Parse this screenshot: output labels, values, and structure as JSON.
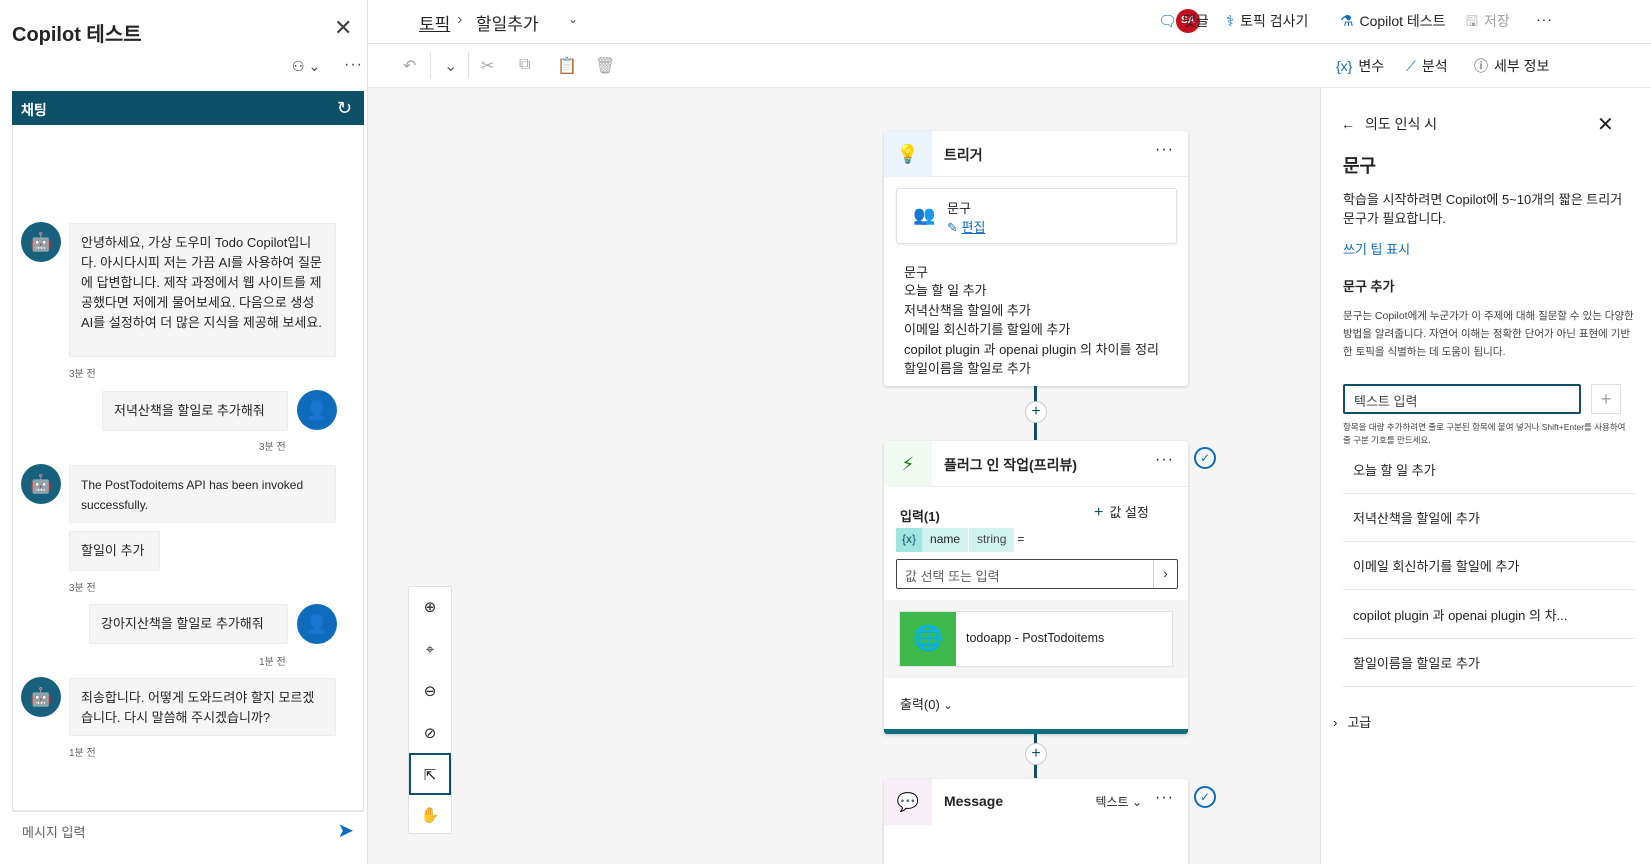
{
  "left_panel": {
    "title": "Copilot 테스트",
    "chat_tab": "채팅",
    "messages": [
      {
        "role": "bot",
        "text": "안녕하세요, 가상 도우미 Todo Copilot입니다. 아시다시피 저는 가끔 AI를 사용하여 질문에 답변합니다. 제작 과정에서 웹 사이트를 제공했다면 저에게 물어보세요. 다음으로 생성 AI를 설정하여 더 많은 지식을 제공해 보세요.",
        "time": "3분 전"
      },
      {
        "role": "user",
        "text": "저녁산책을 할일로 추가해줘",
        "time": "3분 전"
      },
      {
        "role": "bot",
        "text": "The PostTodoitems API has been invoked successfully."
      },
      {
        "role": "bot",
        "text": "할일이 추가",
        "time": "3분 전"
      },
      {
        "role": "user",
        "text": "강아지산책을 할일로 추가해줘",
        "time": "1분 전"
      },
      {
        "role": "bot",
        "text": "죄송합니다. 어떻게 도와드려야 할지 모르겠습니다. 다시 말씀해 주시겠습니까?",
        "time": "1분 전"
      }
    ],
    "input_placeholder": "메시지 입력"
  },
  "topbar": {
    "breadcrumb_root": "토픽",
    "breadcrumb_current": "할일추가",
    "avatar_initials": "SA",
    "comments": "댓글",
    "topic_checker": "토픽 검사기",
    "test_copilot": "Copilot 테스트",
    "save": "저장"
  },
  "toolbar2": {
    "variables": "변수",
    "analytics": "분석",
    "details": "세부 정보"
  },
  "canvas": {
    "trigger_card": {
      "title": "트리거",
      "phrase_label": "문구",
      "edit_link": "편집",
      "phrases_heading": "문구",
      "phrases": [
        "오늘 할 일 추가",
        "저녁산책을 할일에 추가",
        "이메일 회신하기를 할일에 추가",
        "copilot plugin 과 openai plugin 의 차이를 정리",
        "할일이름을 할일로 추가"
      ]
    },
    "plugin_card": {
      "title": "플러그 인 작업(프리뷰)",
      "inputs_label": "입력(1)",
      "set_value": "값 설정",
      "var_token": "{x}",
      "var_name": "name",
      "var_type": "string",
      "equals": "=",
      "value_placeholder": "값 선택 또는 입력",
      "action_name": "todoapp - PostTodoitems",
      "outputs_label": "출력(0)"
    },
    "message_card": {
      "title": "Message",
      "mode": "텍스트"
    }
  },
  "right_panel": {
    "back_label": "의도 인식 시",
    "heading": "문구",
    "description": "학습을 시작하려면 Copilot에 5~10개의 짧은 트리거 문구가 필요합니다.",
    "tips_link": "쓰기 팁 표시",
    "add_heading": "문구 추가",
    "add_description": "문구는 Copilot에게 누군가가 이 주제에 대해 질문할 수 있는 다양한 방법을 알려줍니다. 자연어 이해는 정확한 단어가 아닌 표현에 기반한 토픽을 식별하는 데 도움이 됩니다.",
    "input_placeholder": "텍스트 입력",
    "bulk_hint": "항목을 대량 추가하려면 줄로 구분된 항목에 붙여 넣거나 Shift+Enter를 사용하여 줄 구분 기호를 만드세요.",
    "phrases": [
      "오늘 할 일 추가",
      "저녁산책을 할일에 추가",
      "이메일 회신하기를 할일에 추가",
      "copilot plugin 과 openai plugin 의 차...",
      "할일이름을 할일로 추가"
    ],
    "advanced": "고급"
  }
}
